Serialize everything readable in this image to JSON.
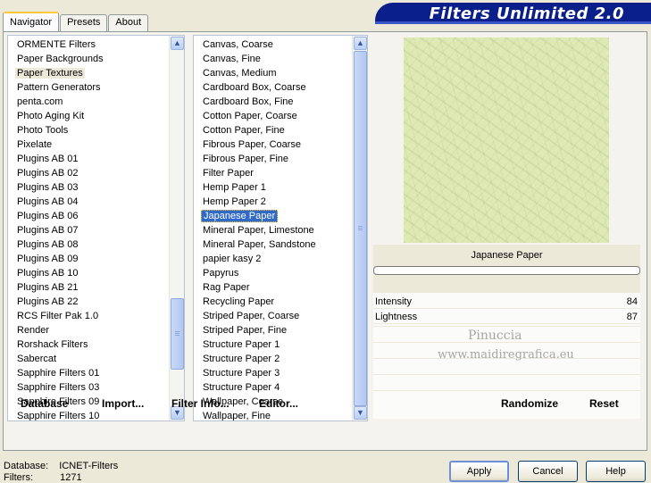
{
  "tabs": [
    {
      "label": "Navigator"
    },
    {
      "label": "Presets"
    },
    {
      "label": "About"
    }
  ],
  "banner": {
    "title": "Filters Unlimited 2.0"
  },
  "categories": [
    "ORMENTE Filters",
    "Paper Backgrounds",
    "Paper Textures",
    "Pattern Generators",
    "penta.com",
    "Photo Aging Kit",
    "Photo Tools",
    "Pixelate",
    "Plugins AB 01",
    "Plugins AB 02",
    "Plugins AB 03",
    "Plugins AB 04",
    "Plugins AB 06",
    "Plugins AB 07",
    "Plugins AB 08",
    "Plugins AB 09",
    "Plugins AB 10",
    "Plugins AB 21",
    "Plugins AB 22",
    "RCS Filter Pak 1.0",
    "Render",
    "Rorshack Filters",
    "Sabercat",
    "Sapphire Filters 01",
    "Sapphire Filters 03",
    "Sapphire Filters 09",
    "Sapphire Filters 10"
  ],
  "selected_category_index": 2,
  "filters": [
    "Canvas, Coarse",
    "Canvas, Fine",
    "Canvas, Medium",
    "Cardboard Box, Coarse",
    "Cardboard Box, Fine",
    "Cotton Paper, Coarse",
    "Cotton Paper, Fine",
    "Fibrous Paper, Coarse",
    "Fibrous Paper, Fine",
    "Filter Paper",
    "Hemp Paper 1",
    "Hemp Paper 2",
    "Japanese Paper",
    "Mineral Paper, Limestone",
    "Mineral Paper, Sandstone",
    "papier kasy 2",
    "Papyrus",
    "Rag Paper",
    "Recycling Paper",
    "Striped Paper, Coarse",
    "Striped Paper, Fine",
    "Structure Paper 1",
    "Structure Paper 2",
    "Structure Paper 3",
    "Structure Paper 4",
    "Wallpaper, Coarse",
    "Wallpaper, Fine"
  ],
  "selected_filter_index": 12,
  "bottom_buttons": {
    "database": "Database",
    "import": "Import...",
    "filter_info": "Filter Info...",
    "editor": "Editor...",
    "randomize": "Randomize",
    "reset": "Reset"
  },
  "preview": {
    "filter_name": "Japanese Paper",
    "progress": 0
  },
  "sliders": [
    {
      "label": "Intensity",
      "value": "84"
    },
    {
      "label": "Lightness",
      "value": "87"
    }
  ],
  "watermark": {
    "line1": "Pinuccia",
    "line2": "www.maidiregrafica.eu"
  },
  "status": {
    "database_label": "Database:",
    "database_value": "ICNET-Filters",
    "filters_label": "Filters:",
    "filters_value": "1271"
  },
  "dialog_buttons": {
    "apply": "Apply",
    "cancel": "Cancel",
    "help": "Help"
  }
}
